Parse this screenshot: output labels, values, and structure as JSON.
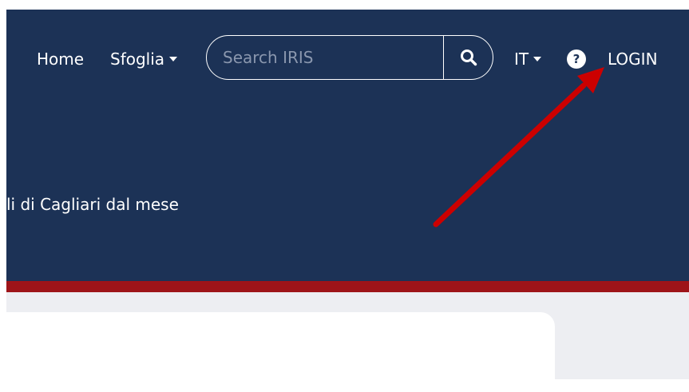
{
  "nav": {
    "home_label": "Home",
    "browse_label": "Sfoglia",
    "language_label": "IT",
    "help_symbol": "?",
    "login_label": "LOGIN"
  },
  "search": {
    "placeholder": "Search IRIS",
    "button_icon": "search-icon"
  },
  "header": {
    "subtitle_fragment": "li di Cagliari dal mese"
  },
  "annotation": {
    "icon": "arrow-pointing-to-login",
    "color": "#cc0000"
  },
  "colors": {
    "header_bg": "#1c3256",
    "accent_bar": "#9e1419",
    "page_bg": "#edeef2"
  }
}
